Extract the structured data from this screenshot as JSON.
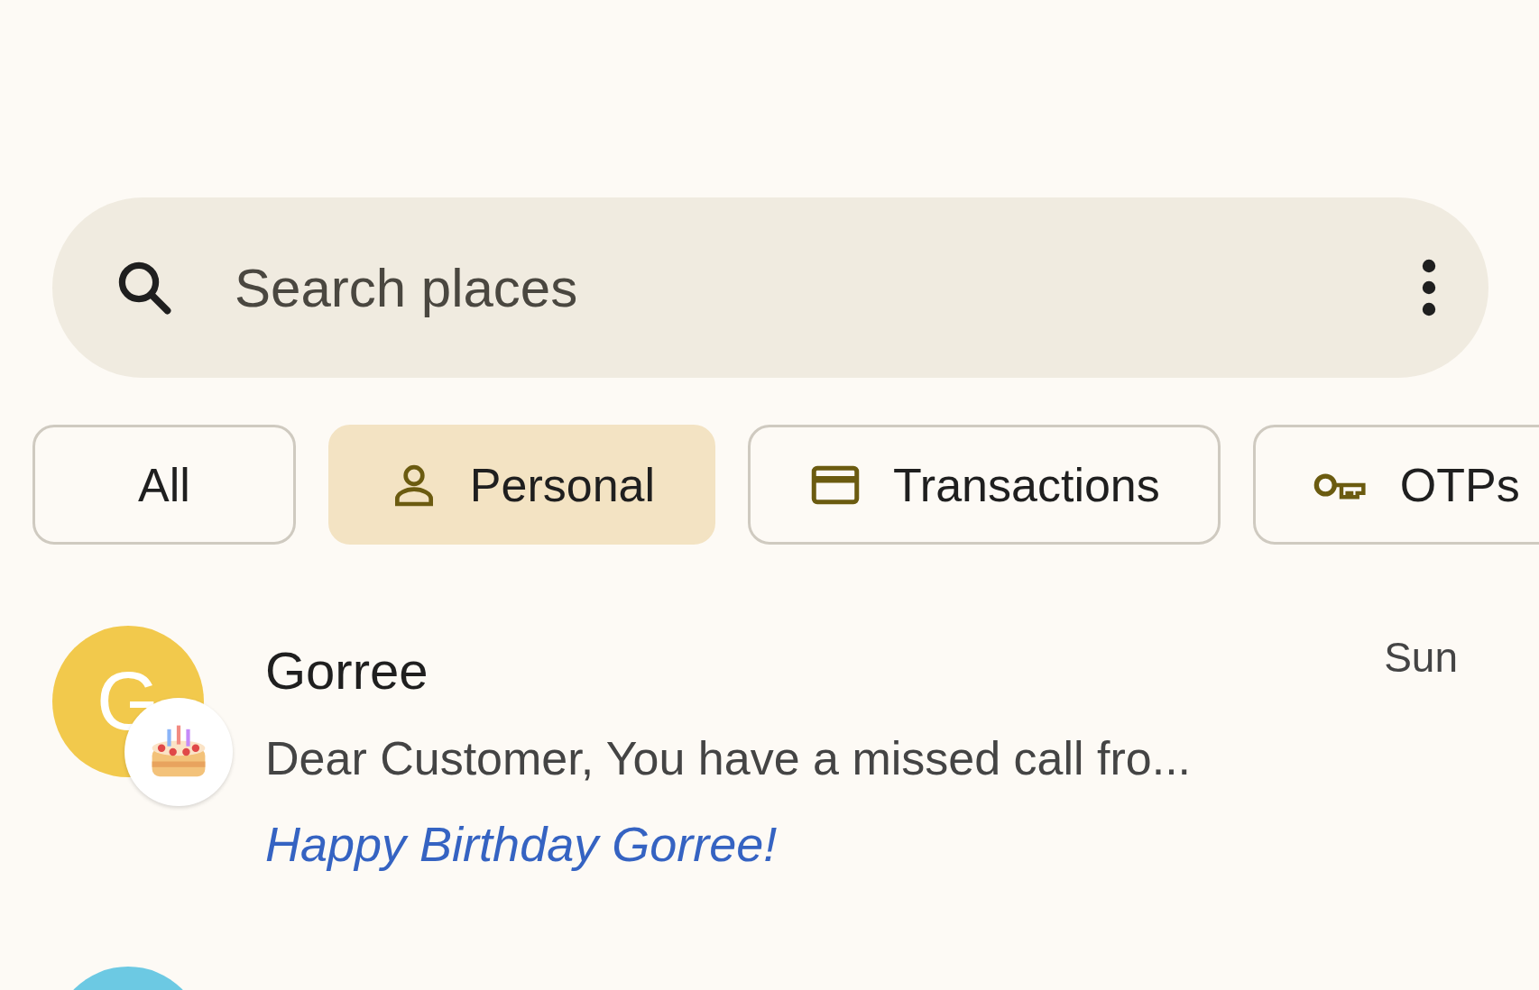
{
  "search": {
    "placeholder": "Search places"
  },
  "filters": [
    {
      "label": "All",
      "kind": "plain",
      "selected": false
    },
    {
      "label": "Personal",
      "kind": "person",
      "selected": true
    },
    {
      "label": "Transactions",
      "kind": "card",
      "selected": false
    },
    {
      "label": "OTPs",
      "kind": "key",
      "selected": false
    }
  ],
  "conversations": [
    {
      "kind": "full",
      "initial": "G",
      "color": "#f2c94c",
      "name": "Gorree",
      "time": "Sun",
      "snippet": "Dear Customer, You have a missed call fro...",
      "greeting": "Happy Birthday Gorree!",
      "birthday": true
    },
    {
      "kind": "partial",
      "color": "#6cc9e3"
    }
  ]
}
